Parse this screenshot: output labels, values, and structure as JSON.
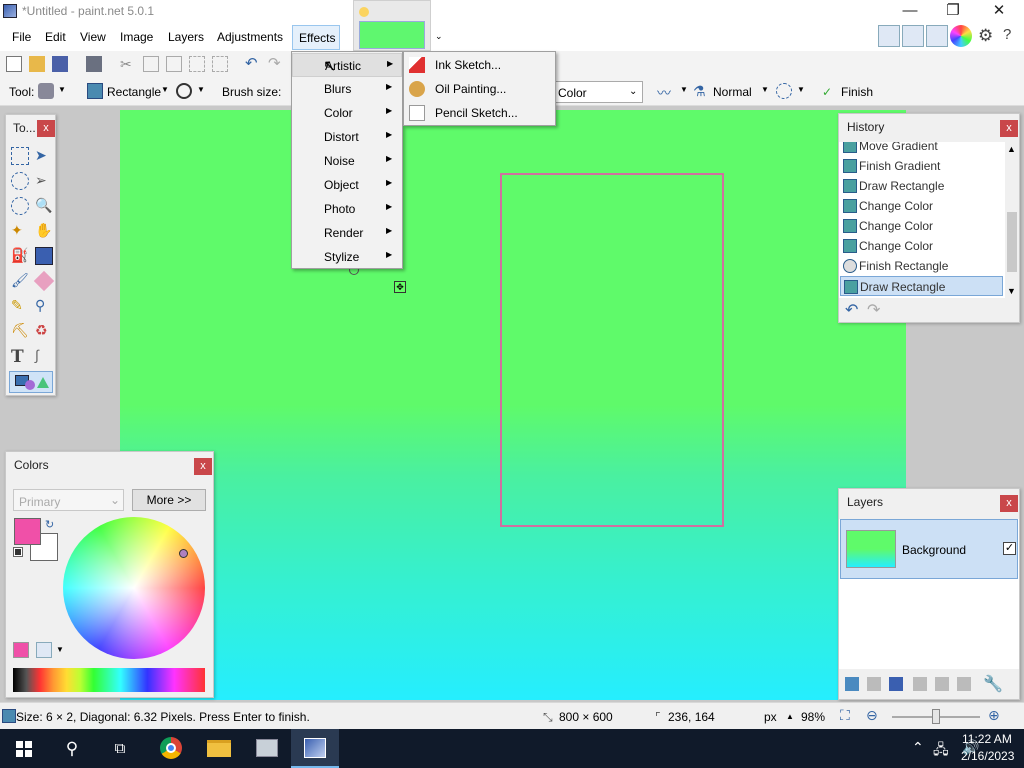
{
  "window": {
    "title": "*Untitled - paint.net 5.0.1",
    "minimize": "—",
    "maximize": "❐",
    "close": "✕"
  },
  "menu": {
    "items": [
      "File",
      "Edit",
      "View",
      "Image",
      "Layers",
      "Adjustments",
      "Effects"
    ]
  },
  "toolbar": {
    "tool_label": "Tool:",
    "shape_label": "Rectangle",
    "brush_size_label": "Brush size:",
    "fill_label": "Color",
    "blend_label": "Normal",
    "finish_label": "Finish"
  },
  "effects_menu": {
    "items": [
      {
        "label": "Artistic",
        "display": "Artistic"
      },
      {
        "label": "Blurs"
      },
      {
        "label": "Color"
      },
      {
        "label": "Distort"
      },
      {
        "label": "Noise"
      },
      {
        "label": "Object"
      },
      {
        "label": "Photo"
      },
      {
        "label": "Render"
      },
      {
        "label": "Stylize"
      }
    ],
    "artistic_submenu": [
      "Ink Sketch...",
      "Oil Painting...",
      "Pencil Sketch..."
    ]
  },
  "tools_panel": {
    "title": "To..."
  },
  "history_panel": {
    "title": "History",
    "items": [
      "Move Gradient",
      "Finish Gradient",
      "Draw Rectangle",
      "Change Color",
      "Change Color",
      "Change Color",
      "Finish Rectangle",
      "Draw Rectangle"
    ],
    "selected_index": 7
  },
  "layers_panel": {
    "title": "Layers",
    "layers": [
      {
        "name": "Background",
        "visible": true
      }
    ]
  },
  "colors_panel": {
    "title": "Colors",
    "mode": "Primary",
    "more_button": "More >>",
    "primary_color": "#f050a8",
    "secondary_color": "#ffffff"
  },
  "statusbar": {
    "message": "Size: 6 × 2, Diagonal: 6.32 Pixels. Press Enter to finish.",
    "image_size": "800 × 600",
    "cursor_pos": "236, 164",
    "unit": "px",
    "zoom": "98%"
  },
  "taskbar": {
    "time": "11:22 AM",
    "date": "2/16/2023"
  },
  "colors": {
    "canvas_top": "#5ffa6a",
    "canvas_bottom": "#25eeff",
    "rect_outline": "#d070a0",
    "close_red": "#c9474a"
  }
}
